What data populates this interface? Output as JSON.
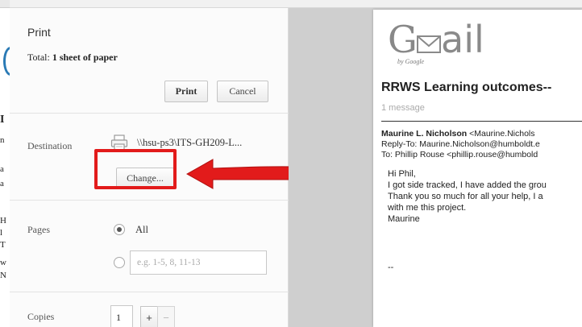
{
  "background_page": {
    "fragments": [
      "I",
      "n",
      "a",
      "a",
      "H",
      "l",
      "T",
      "w",
      "N"
    ]
  },
  "dialog": {
    "title": "Print",
    "total_label": "Total:",
    "total_value": "1 sheet of paper",
    "print_button": "Print",
    "cancel_button": "Cancel",
    "destination_label": "Destination",
    "printer_name": "\\\\hsu-ps3\\ITS-GH209-L...",
    "change_button": "Change...",
    "pages_label": "Pages",
    "pages_all_label": "All",
    "pages_all_selected": true,
    "pages_placeholder": "e.g. 1-5, 8, 11-13",
    "copies_label": "Copies",
    "copies_value": "1",
    "copies_plus": "+",
    "copies_minus": "−"
  },
  "annotation": {
    "color": "#e21b1b",
    "target": "change-button"
  },
  "preview": {
    "logo_g": "G",
    "logo_ail": "ail",
    "logo_by": "by Google",
    "subject": "RRWS Learning outcomes--",
    "message_count": "1 message",
    "from_name": "Maurine L. Nicholson",
    "from_email": " <Maurine.Nichols",
    "reply_to": "Reply-To: Maurine.Nicholson@humboldt.e",
    "to": "To: Phillip Rouse <phillip.rouse@humbold",
    "body": [
      "Hi Phil,",
      "I got side tracked, I have added the grou",
      "Thank you so much for all your help, I a",
      "with me this project.",
      "Maurine",
      "",
      "--"
    ]
  },
  "colors": {
    "panel_bg": "#fbfbfb",
    "preview_bg": "#cfcfcf",
    "highlight": "#e21b1b"
  }
}
